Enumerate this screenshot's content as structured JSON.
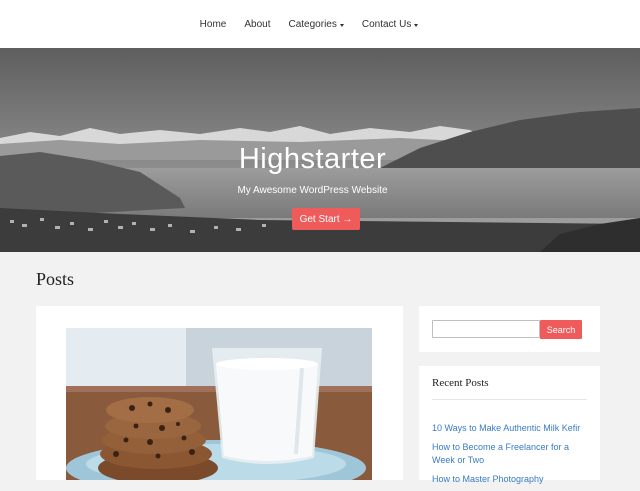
{
  "nav": {
    "items": [
      {
        "label": "Home",
        "dropdown": false
      },
      {
        "label": "About",
        "dropdown": false
      },
      {
        "label": "Categories",
        "dropdown": true
      },
      {
        "label": "Contact Us",
        "dropdown": true
      }
    ]
  },
  "hero": {
    "title": "Highstarter",
    "subtitle": "My Awesome WordPress Website",
    "button_label": "Get Start →"
  },
  "main": {
    "section_title": "Posts",
    "post_image": "cookies-and-milk-photo"
  },
  "sidebar": {
    "search": {
      "value": "",
      "placeholder": "",
      "button_label": "Search"
    },
    "recent": {
      "title": "Recent Posts",
      "items": [
        "10 Ways to Make Authentic Milk Kefir",
        "How to Become a Freelancer for a Week or Two",
        "How to Master Photography"
      ]
    }
  },
  "colors": {
    "accent": "#ef5b5b",
    "link": "#3a7bc8",
    "page_bg": "#f2f2f2",
    "card_bg": "#ffffff"
  }
}
